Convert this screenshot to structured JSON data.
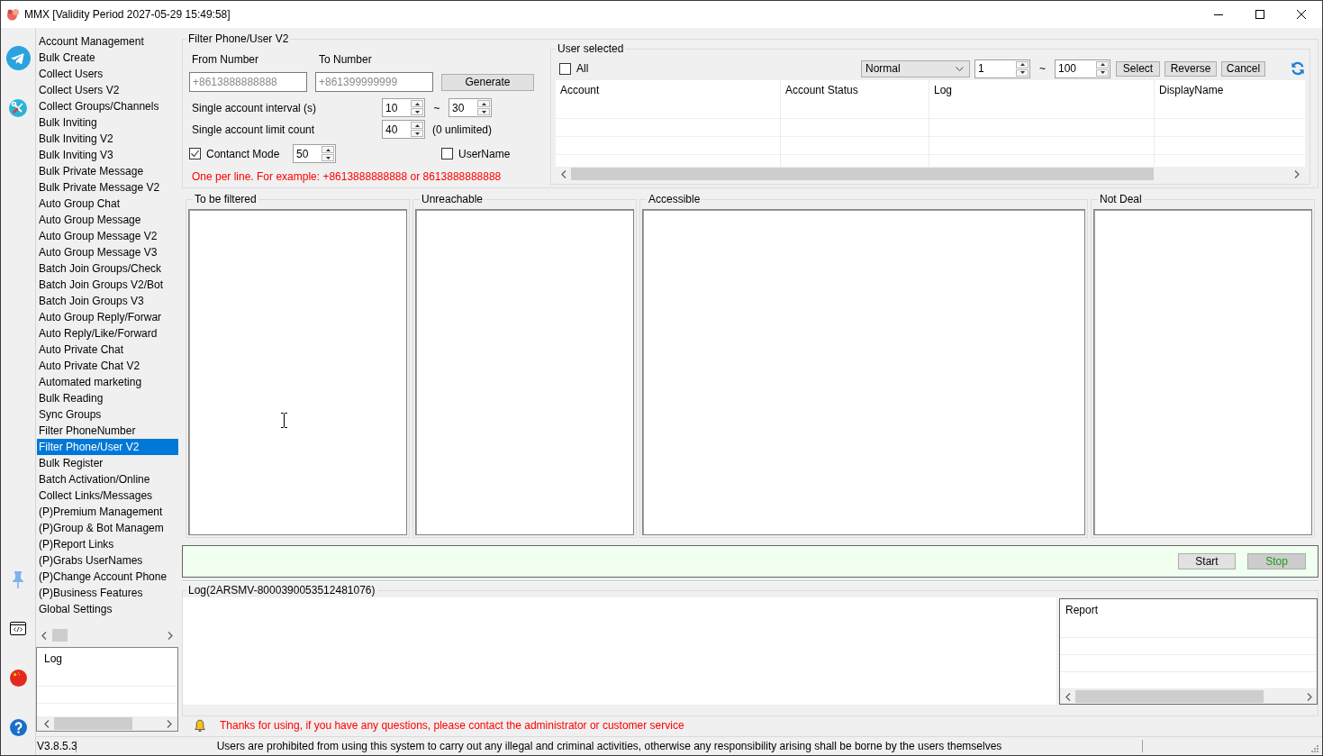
{
  "window": {
    "title": "MMX [Validity Period 2027-05-29 15:49:58]"
  },
  "sidebar": {
    "items": [
      {
        "label": "Account Management",
        "selected": false
      },
      {
        "label": "Bulk Create",
        "selected": false
      },
      {
        "label": "Collect Users",
        "selected": false
      },
      {
        "label": "Collect Users V2",
        "selected": false
      },
      {
        "label": "Collect Groups/Channels",
        "selected": false
      },
      {
        "label": "Bulk Inviting",
        "selected": false
      },
      {
        "label": "Bulk Inviting V2",
        "selected": false
      },
      {
        "label": "Bulk Inviting V3",
        "selected": false
      },
      {
        "label": "Bulk Private Message",
        "selected": false
      },
      {
        "label": "Bulk Private Message V2",
        "selected": false
      },
      {
        "label": "Auto Group Chat",
        "selected": false
      },
      {
        "label": "Auto Group Message",
        "selected": false
      },
      {
        "label": "Auto Group Message V2",
        "selected": false
      },
      {
        "label": "Auto Group Message V3",
        "selected": false
      },
      {
        "label": "Batch Join Groups/Check",
        "selected": false
      },
      {
        "label": "Batch Join Groups V2/Bot",
        "selected": false
      },
      {
        "label": "Batch Join Groups V3",
        "selected": false
      },
      {
        "label": "Auto Group Reply/Forwar",
        "selected": false
      },
      {
        "label": "Auto Reply/Like/Forward",
        "selected": false
      },
      {
        "label": "Auto Private Chat",
        "selected": false
      },
      {
        "label": "Auto Private Chat V2",
        "selected": false
      },
      {
        "label": "Automated marketing",
        "selected": false
      },
      {
        "label": "Bulk Reading",
        "selected": false
      },
      {
        "label": "Sync Groups",
        "selected": false
      },
      {
        "label": "Filter PhoneNumber",
        "selected": false
      },
      {
        "label": "Filter Phone/User V2",
        "selected": true
      },
      {
        "label": "Bulk Register",
        "selected": false
      },
      {
        "label": "Batch Activation/Online",
        "selected": false
      },
      {
        "label": "Collect Links/Messages",
        "selected": false
      },
      {
        "label": "(P)Premium Management",
        "selected": false
      },
      {
        "label": "(P)Group & Bot Managem",
        "selected": false
      },
      {
        "label": "(P)Report Links",
        "selected": false
      },
      {
        "label": "(P)Grabs UserNames",
        "selected": false
      },
      {
        "label": "(P)Change Account Phone",
        "selected": false
      },
      {
        "label": "(P)Business Features",
        "selected": false
      },
      {
        "label": "Global Settings",
        "selected": false
      }
    ]
  },
  "sidebar_log": {
    "header": "Log"
  },
  "filter_panel": {
    "title": "Filter Phone/User V2",
    "from_number": {
      "label": "From Number",
      "placeholder": "+8613888888888"
    },
    "to_number": {
      "label": "To Number",
      "placeholder": "+861399999999"
    },
    "generate_button": "Generate",
    "interval": {
      "label": "Single account interval (s)",
      "min": "10",
      "separator": "~",
      "max": "30"
    },
    "limit": {
      "label": "Single account limit count",
      "value": "40",
      "note": "(0 unlimited)"
    },
    "contact_mode": {
      "label": "Contanct Mode",
      "checked": true,
      "value": "50"
    },
    "username": {
      "label": "UserName",
      "checked": false
    },
    "hint": "One per line. For example: +8613888888888 or 8613888888888"
  },
  "user_selected": {
    "title": "User selected",
    "all": {
      "label": "All",
      "checked": false
    },
    "mode_dropdown": "Normal",
    "range": {
      "from": "1",
      "separator": "~",
      "to": "100"
    },
    "buttons": [
      "Select",
      "Reverse",
      "Cancel"
    ],
    "table": {
      "columns": [
        "Account",
        "Account Status",
        "Log",
        "DisplayName"
      ]
    }
  },
  "lists": [
    {
      "title": "To be filtered"
    },
    {
      "title": "Unreachable"
    },
    {
      "title": "Accessible"
    },
    {
      "title": "Not Deal"
    }
  ],
  "actions": [
    {
      "label": "Start",
      "kind": "start"
    },
    {
      "label": "Stop",
      "kind": "stop"
    }
  ],
  "log_panel": {
    "title": "Log(2ARSMV-8000390053512481076)",
    "report": {
      "header": "Report"
    }
  },
  "notice": "Thanks for using, if you have any questions, please contact the administrator or customer service",
  "status_bar": {
    "version": "V3.8.5.3",
    "message": "Users are prohibited from using this system to carry out any illegal and criminal activities, otherwise any responsibility arising shall be borne by the users themselves"
  }
}
